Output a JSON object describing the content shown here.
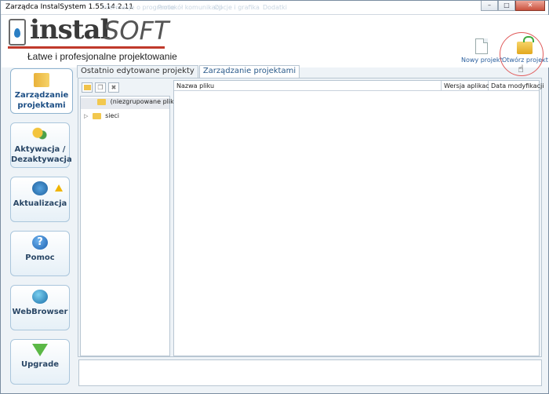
{
  "window": {
    "title": "Zarządca InstalSystem 1.55.14.2.11",
    "ghost_menu": [
      "Informacje o programie",
      "Protokół komunikacji",
      "Opcje i grafika",
      "Dodatki"
    ]
  },
  "header": {
    "logo_instal": "instal",
    "logo_soft": "SOFT",
    "tagline": "Łatwe i profesjonalne projektowanie",
    "new_project": "Nowy projekt",
    "open_project": "Otwórz projekt"
  },
  "sidebar": {
    "items": [
      {
        "label": "Zarządzanie\nprojektami",
        "icon": "book-icon"
      },
      {
        "label": "Aktywacja /\nDezaktywacja",
        "icon": "keys-icon"
      },
      {
        "label": "Aktualizacja",
        "icon": "globe-arrows-icon",
        "warning": true
      },
      {
        "label": "Pomoc",
        "icon": "help-icon",
        "glyph": "?"
      },
      {
        "label": "WebBrowser",
        "icon": "globe-icon"
      },
      {
        "label": "Upgrade",
        "icon": "arrow-down-icon"
      }
    ]
  },
  "tabs": [
    {
      "label": "Ostatnio edytowane projekty",
      "active": false
    },
    {
      "label": "Zarządzanie projektami",
      "active": true
    }
  ],
  "tree": {
    "items": [
      {
        "label": "(niezgrupowane pliki)",
        "selected": true,
        "expandable": false
      },
      {
        "label": "sieci",
        "selected": false,
        "expandable": true
      }
    ]
  },
  "files": {
    "columns": [
      "Nazwa pliku",
      "Wersja aplikacji",
      "Data modyfikacji"
    ]
  }
}
